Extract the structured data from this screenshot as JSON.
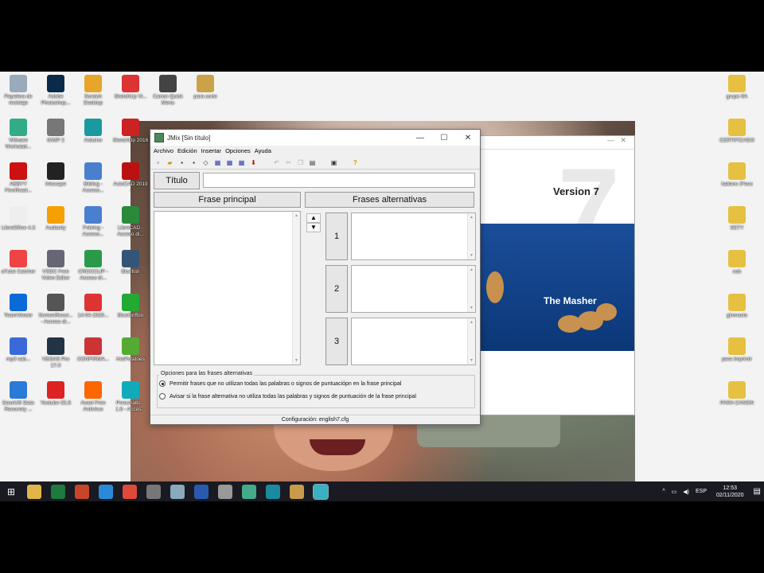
{
  "desktop": {
    "left_icons": [
      {
        "label": "Papelera de reciclaje",
        "color": "#9ab"
      },
      {
        "label": "Adobe Photoshop...",
        "color": "#0b2a4a"
      },
      {
        "label": "Scratch Desktop",
        "color": "#e6a62a"
      },
      {
        "label": "SketchUp Vi...",
        "color": "#d33"
      },
      {
        "label": "Canon Quick Menu",
        "color": "#444"
      },
      {
        "label": "para corte",
        "color": "#c9a24a"
      },
      {
        "label": "VMware Workstati...",
        "color": "#3a8"
      },
      {
        "label": "GIMP 2",
        "color": "#777"
      },
      {
        "label": "Arduino",
        "color": "#1a9aa0"
      },
      {
        "label": "SketchUp 2016",
        "color": "#c22"
      },
      {
        "label": "ABBYY FineRead...",
        "color": "#c11"
      },
      {
        "label": "Inkscape",
        "color": "#222"
      },
      {
        "label": "Bibliog - Acceso...",
        "color": "#4a7fd0"
      },
      {
        "label": "AutoCAD 2019 -",
        "color": "#b11"
      },
      {
        "label": "LibreOffice 4.3",
        "color": "#eee"
      },
      {
        "label": "Audacity",
        "color": "#f5a000"
      },
      {
        "label": "Fnbring - Acceso...",
        "color": "#4a7fd0"
      },
      {
        "label": "LibreCAD - Acceso di...",
        "color": "#2a8a3a"
      },
      {
        "label": "aTube Catcher",
        "color": "#e44"
      },
      {
        "label": "VSDC Free Video Editor",
        "color": "#667"
      },
      {
        "label": "CROCCLIP - Acceso di...",
        "color": "#2a9a4a"
      },
      {
        "label": "Bluefish",
        "color": "#357"
      },
      {
        "label": "TeamViewer",
        "color": "#0a6ad8"
      },
      {
        "label": "ScreenRecor... - Acceso di...",
        "color": "#555"
      },
      {
        "label": "14-04-2020...",
        "color": "#d33"
      },
      {
        "label": "BlueGriffon",
        "color": "#2a3"
      },
      {
        "label": "mp3 sab...",
        "color": "#3a6ad8"
      },
      {
        "label": "VEGAS Pro 17.0",
        "color": "#234"
      },
      {
        "label": "CONFIRMA...",
        "color": "#c33"
      },
      {
        "label": "HotPotatoes",
        "color": "#5a3"
      },
      {
        "label": "EaseUS Data Recovery ...",
        "color": "#2a7ad8"
      },
      {
        "label": "Youtube OLS",
        "color": "#d22"
      },
      {
        "label": "Avast Free Antivirus",
        "color": "#f60"
      },
      {
        "label": "Pneumatic... 1.8 - Acces...",
        "color": "#1ab"
      }
    ],
    "right_icons": [
      {
        "label": "grupo 9A",
        "color": "#e6c040"
      },
      {
        "label": "CERTIFICADO",
        "color": "#e6c040"
      },
      {
        "label": "Italiano 3ºeso",
        "color": "#e6c040"
      },
      {
        "label": "SETY",
        "color": "#e6c040"
      },
      {
        "label": "cob",
        "color": "#e6c040"
      },
      {
        "label": "gimnasio",
        "color": "#e6c040"
      },
      {
        "label": "para imprimir",
        "color": "#e6c040"
      },
      {
        "label": "PARA CANON",
        "color": "#e6c040"
      }
    ]
  },
  "background_window": {
    "version_text": "Version 7",
    "big_digit": "7",
    "product_text": "The Masher"
  },
  "jmix": {
    "title": "JMix [Sin título]",
    "controls": {
      "minimize": "—",
      "maximize": "☐",
      "close": "✕"
    },
    "menu": [
      "Archivo",
      "Edición",
      "Insertar",
      "Opciones",
      "Ayuda"
    ],
    "toolbar_icons": [
      "new-icon",
      "open-icon",
      "save-icon",
      "save-as-icon",
      "erase-icon",
      "export-icon",
      "export2-icon",
      "export3-icon",
      "down-arrow-icon",
      "undo-icon",
      "cut-icon",
      "copy-icon",
      "paste-icon",
      "screens-icon",
      "help-icon"
    ],
    "titulo_label": "Título",
    "titulo_value": "",
    "frase_principal_label": "Frase principal",
    "frases_alternativas_label": "Frases alternativas",
    "alt_numbers": [
      "1",
      "2",
      "3"
    ],
    "options_legend": "Opciones para las frases alternativas",
    "option1": "Permitir frases que no utilizan todas las palabras o signos de puntuaciópn en la frase principal",
    "option2": "Avisar si la frase alternativa no utiliza todas las palabras y signos de puntuación de la frase principal",
    "option_selected": 1,
    "status": "Configuración: english7.cfg"
  },
  "taskbar": {
    "apps": [
      {
        "name": "explorer",
        "color": "#e0b64a"
      },
      {
        "name": "excel",
        "color": "#1e7a3e"
      },
      {
        "name": "powerpoint",
        "color": "#c8452a"
      },
      {
        "name": "edge",
        "color": "#2a8ad8"
      },
      {
        "name": "chrome",
        "color": "#e04a3a"
      },
      {
        "name": "tool1",
        "color": "#777"
      },
      {
        "name": "tool2",
        "color": "#8ab"
      },
      {
        "name": "word",
        "color": "#2a5ab0"
      },
      {
        "name": "tool3",
        "color": "#999"
      },
      {
        "name": "tool4",
        "color": "#4a8"
      },
      {
        "name": "tool5",
        "color": "#1a8aa0"
      },
      {
        "name": "hotpotatoes",
        "color": "#c89a4a"
      },
      {
        "name": "jmix",
        "color": "#3ab0c0"
      }
    ],
    "language": "ESP",
    "time": "12:53",
    "date": "02/11/2020"
  }
}
